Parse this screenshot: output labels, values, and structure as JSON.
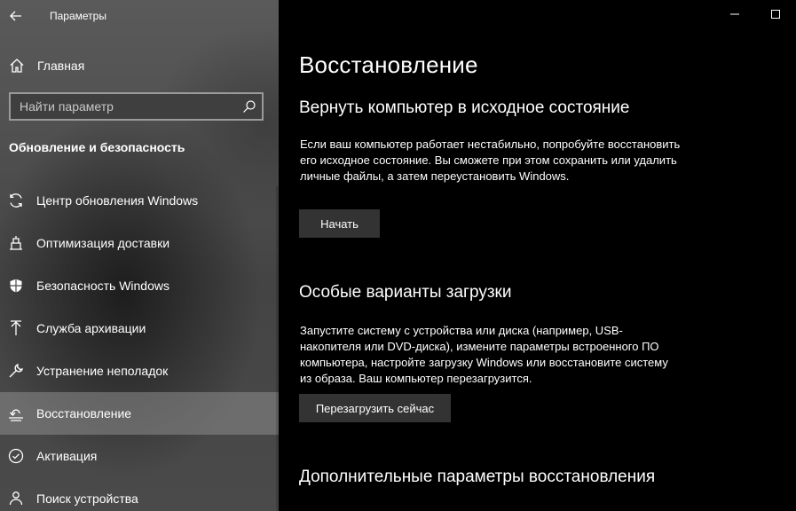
{
  "window": {
    "title": "Параметры"
  },
  "sidebar": {
    "home_label": "Главная",
    "search_placeholder": "Найти параметр",
    "section_title": "Обновление и безопасность",
    "items": [
      {
        "label": "Центр обновления Windows",
        "icon": "sync-icon"
      },
      {
        "label": "Оптимизация доставки",
        "icon": "delivery-icon"
      },
      {
        "label": "Безопасность Windows",
        "icon": "shield-icon"
      },
      {
        "label": "Служба архивации",
        "icon": "backup-arrow-icon"
      },
      {
        "label": "Устранение неполадок",
        "icon": "wrench-icon"
      },
      {
        "label": "Восстановление",
        "icon": "recovery-icon",
        "active": true
      },
      {
        "label": "Активация",
        "icon": "check-circle-icon"
      },
      {
        "label": "Поиск устройства",
        "icon": "person-pin-icon"
      }
    ]
  },
  "main": {
    "page_title": "Восстановление",
    "reset": {
      "heading": "Вернуть компьютер в исходное состояние",
      "description": "Если ваш компьютер работает нестабильно, попробуйте восстановить его исходное состояние. Вы сможете при этом сохранить или удалить личные файлы, а затем переустановить Windows.",
      "button": "Начать"
    },
    "advanced_startup": {
      "heading": "Особые варианты загрузки",
      "description": "Запустите систему с устройства или диска (например, USB-накопителя или DVD-диска), измените параметры встроенного ПО компьютера, настройте загрузку Windows или восстановите систему из образа. Ваш компьютер перезагрузится.",
      "button": "Перезагрузить сейчас"
    },
    "more_options": {
      "heading": "Дополнительные параметры восстановления"
    }
  },
  "colors": {
    "sidebar_bg": "#4f4f4f",
    "main_bg": "#000000",
    "button_bg": "#333333",
    "active_item_bg": "#7a7a7a",
    "link_color": "#4ca0e0"
  }
}
